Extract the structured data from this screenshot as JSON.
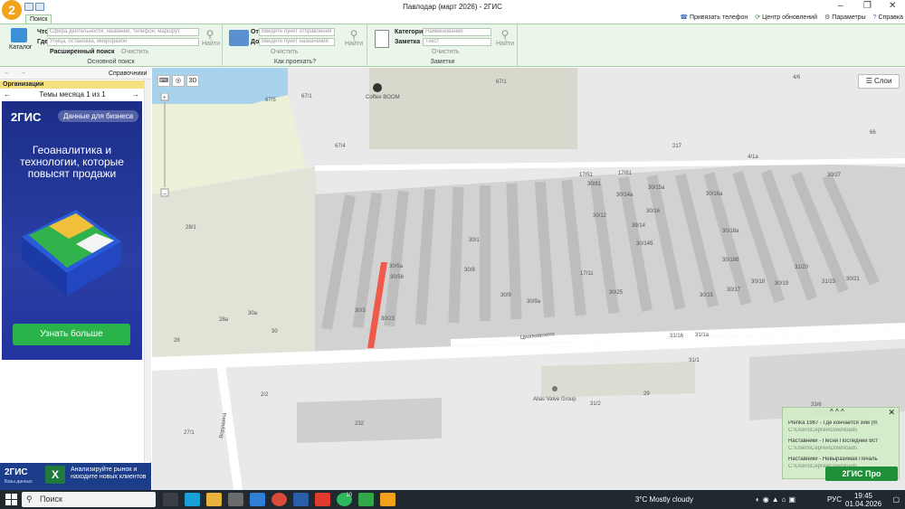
{
  "window": {
    "title": "Павлодар (март 2026) - 2ГИС",
    "minimize": "–",
    "maximize": "❐",
    "close": "✕"
  },
  "app": {
    "logo": "2"
  },
  "tabs": {
    "search": "Поиск"
  },
  "top_links": {
    "bind_phone": "Привязать телефон",
    "updates": "Центр обновлений",
    "settings": "Параметры",
    "help": "Справка"
  },
  "ribbon": {
    "catalog": "Каталог",
    "what_label": "Что",
    "what_placeholder": "Сфера деятельности, название, телефон, маршрут",
    "where_label": "Где",
    "where_placeholder": "Улица, остановка, микрорайон",
    "find": "Найти",
    "advanced": "Расширенный поиск",
    "clear": "Очистить",
    "main_search_group": "Основной поиск",
    "from_label": "От",
    "from_placeholder": "Введите пункт отправления",
    "to_label": "До",
    "to_placeholder": "Введите пункт назначения",
    "route_group": "Как проехать?",
    "category_label": "Категория",
    "category_value": "Наименование",
    "note_label": "Заметка",
    "note_placeholder": "Текст",
    "notes_group": "Заметки"
  },
  "sidebar": {
    "reference": "Справочники",
    "org_header": "Организации",
    "themes": "Темы месяца 1 из 1",
    "ad": {
      "logo": "2ГИС",
      "pill": "Данные для бизнеса",
      "text": "Геоаналитика и технологии, которые повысят продажи",
      "button": "Узнать больше"
    },
    "bottom": {
      "logo": "2ГИС",
      "sub": "Базы данных",
      "excel": "X",
      "text": "Анализируйте рынок и находите новых клиентов"
    }
  },
  "map": {
    "tools": [
      "⌨",
      "◎",
      "3D"
    ],
    "layers": "Слои",
    "poi": [
      {
        "name": "Coffee BOOM"
      },
      {
        "name": "Alias Valve Group"
      }
    ],
    "streets": [
      "Циолковского",
      "Ворушина"
    ],
    "labels": [
      "67/5",
      "67/1",
      "67/1",
      "67/4",
      "67/3",
      "217",
      "4/1а",
      "4/6",
      "66",
      "28/1",
      "28а",
      "30а",
      "30",
      "28",
      "2/2",
      "27/1",
      "232",
      "17/51",
      "17/61",
      "30/81",
      "30/27",
      "30/56",
      "30/56",
      "30/3",
      "30/23",
      "30/1",
      "30/9",
      "30/9а",
      "30/12",
      "30/14а",
      "30/15а",
      "30/16",
      "30/16а",
      "30/18а",
      "30/18б",
      "30/18",
      "30/17",
      "30/19",
      "30/25",
      "31/20",
      "31/23",
      "30/21",
      "39/14",
      "30/14б",
      "30/15",
      "31/16",
      "31/1а",
      "31/1",
      "29",
      "31/2",
      "33/6",
      "17/11",
      "30/8"
    ]
  },
  "notifications": {
    "items": [
      {
        "title": "Plenka 1987 - Где кончается зим (m",
        "path": "C:\\Users\\Сергей\\Downloads"
      },
      {
        "title": "Наставники - Песня Последней Вст",
        "path": "C:\\Users\\Сергей\\Downloads"
      },
      {
        "title": "Наставники - Невыразимая Печаль",
        "path": "C:\\Users\\Сергей\\Downloads"
      }
    ],
    "pro_button": "2ГИС Про"
  },
  "taskbar": {
    "search": "Поиск",
    "weather": "3°C  Mostly cloudy",
    "lang": "РУС",
    "time": "19:45",
    "date": "01.04.2026",
    "whatsapp_badge": "10"
  },
  "colors": {
    "accent": "#2aa84a",
    "route": "#f05a4a",
    "ribbon": "#eaf6ea"
  }
}
